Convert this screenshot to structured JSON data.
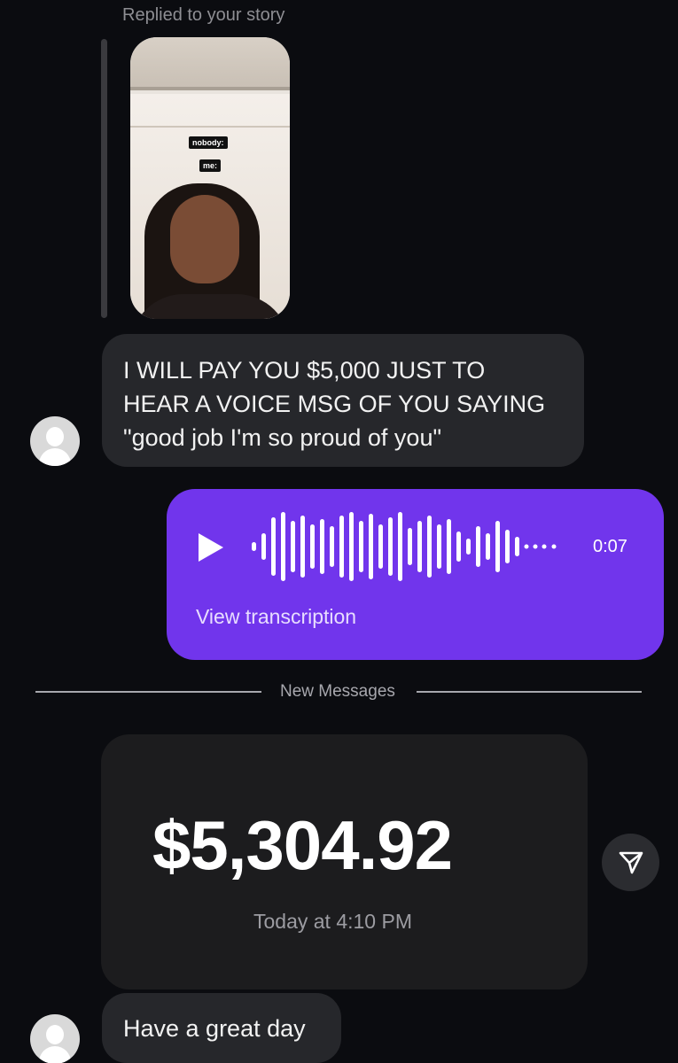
{
  "story_reply": {
    "label": "Replied to your story",
    "sticker_1": "nobody:",
    "sticker_2": "me:"
  },
  "messages": {
    "incoming_1": {
      "line_1": "I WILL PAY YOU $5,000 JUST TO",
      "line_2": "HEAR A VOICE MSG OF YOU SAYING",
      "line_3": "\"good job I'm so proud of you\""
    },
    "voice_message": {
      "duration": "0:07",
      "transcription_link": "View transcription",
      "color": "#7135ec"
    },
    "new_messages_divider": "New Messages",
    "payment": {
      "amount": "$5,304.92",
      "timestamp": "Today at 4:10 PM"
    },
    "incoming_2": {
      "text": "Have a great day"
    }
  },
  "icons": {
    "avatar": "user-placeholder-icon",
    "play": "play-icon",
    "waveform": "waveform-icon",
    "share": "send-icon"
  }
}
